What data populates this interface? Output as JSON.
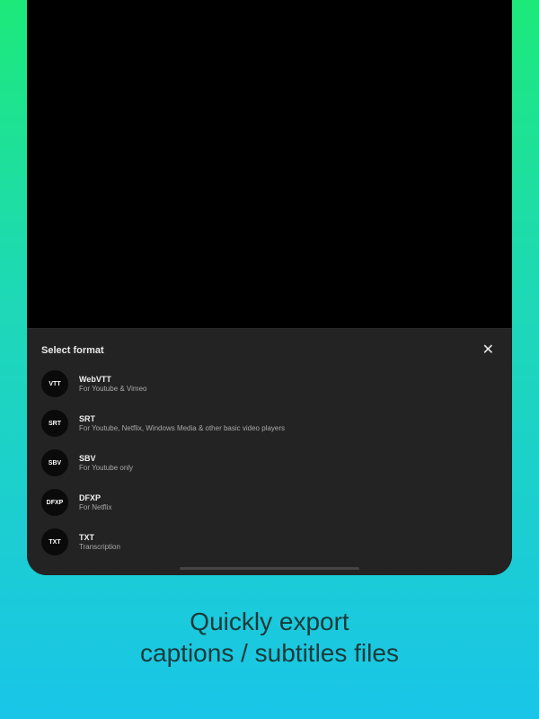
{
  "sheet": {
    "title": "Select format",
    "close": "✕"
  },
  "formats": [
    {
      "badge": "VTT",
      "name": "WebVTT",
      "desc": "For Youtube & Vimeo"
    },
    {
      "badge": "SRT",
      "name": "SRT",
      "desc": "For Youtube, Netflix, Windows Media & other basic video players"
    },
    {
      "badge": "SBV",
      "name": "SBV",
      "desc": "For Youtube only"
    },
    {
      "badge": "DFXP",
      "name": "DFXP",
      "desc": "For Netflix"
    },
    {
      "badge": "TXT",
      "name": "TXT",
      "desc": "Transcription"
    }
  ],
  "caption": {
    "line1": "Quickly export",
    "line2": "captions / subtitles files"
  }
}
